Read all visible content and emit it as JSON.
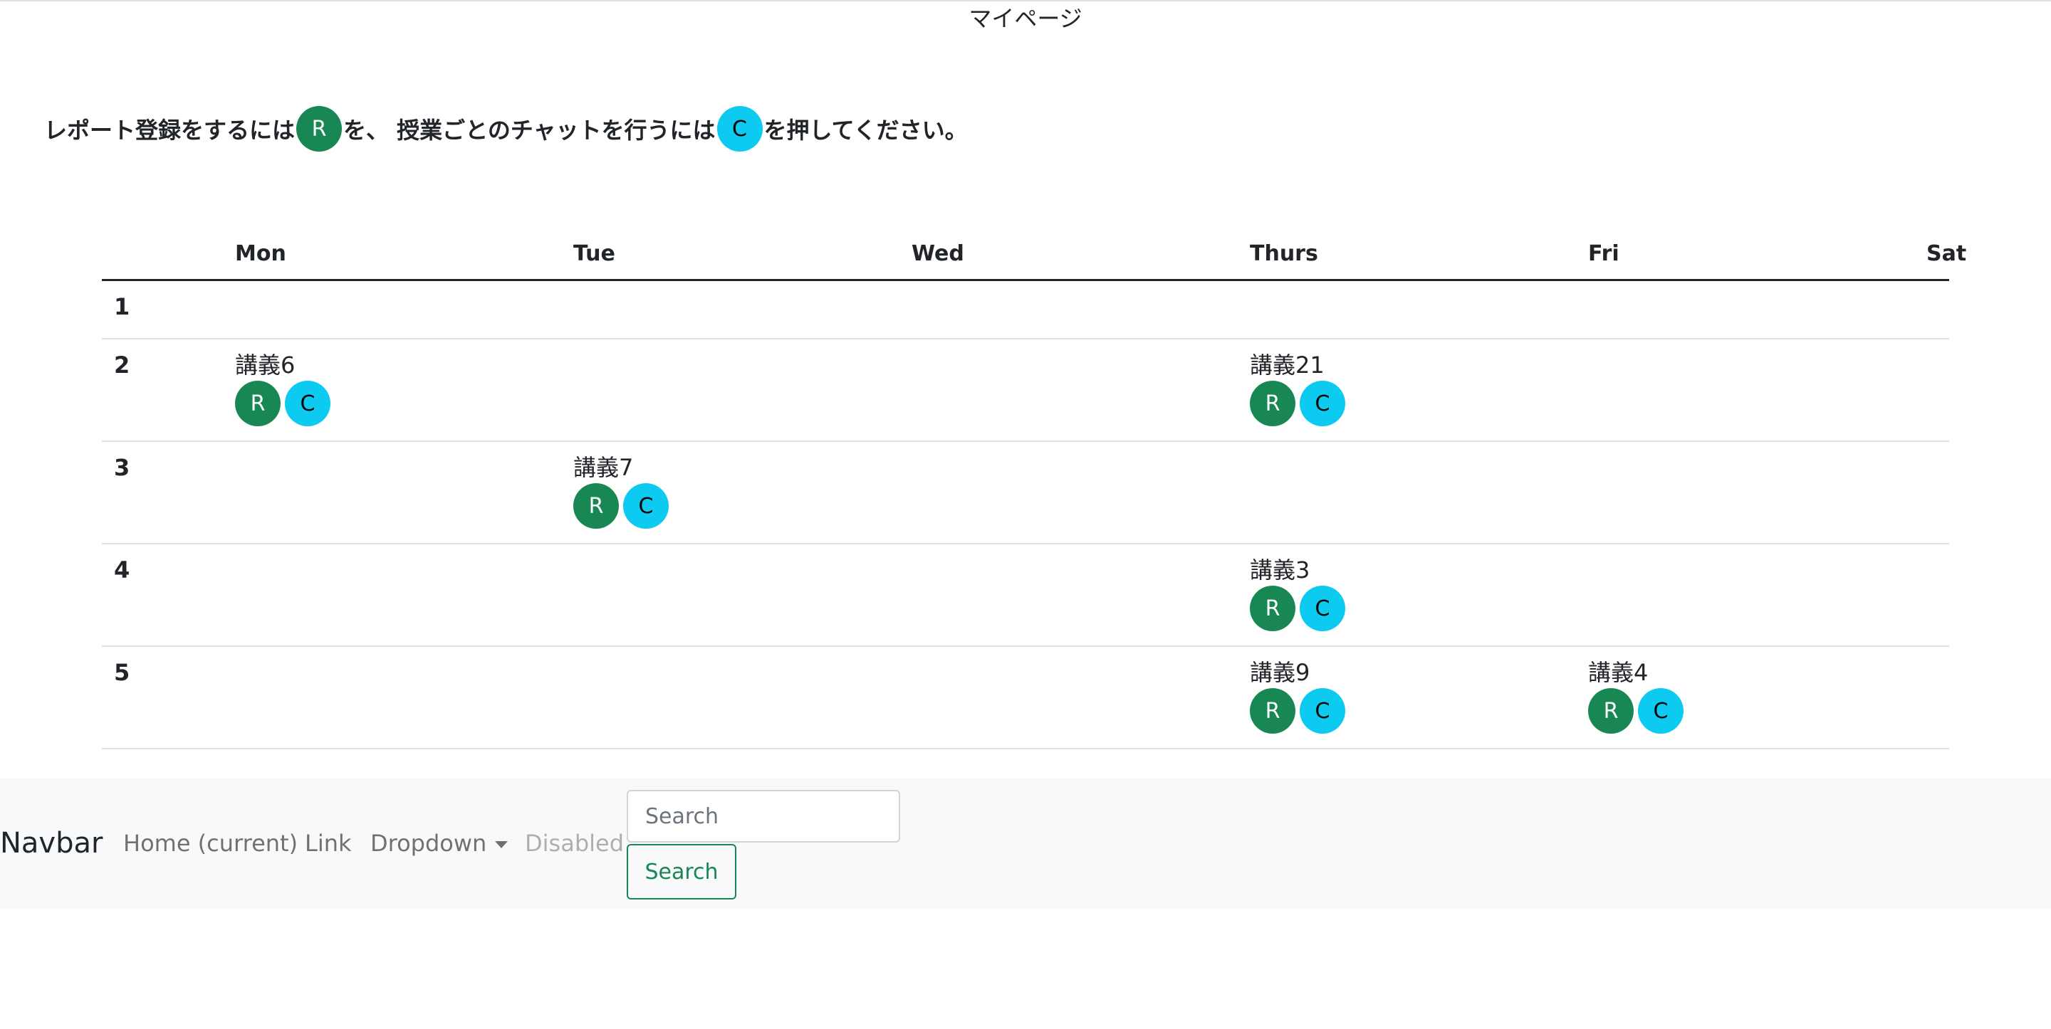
{
  "page": {
    "title": "マイページ",
    "instructions": {
      "part1": "レポート登録をするには",
      "r_label": "R",
      "part2": "を、 授業ごとのチャットを行うには",
      "c_label": "C",
      "part3": "を押してください。"
    }
  },
  "timetable": {
    "days": [
      "Mon",
      "Tue",
      "Wed",
      "Thurs",
      "Fri",
      "Sat"
    ],
    "periods": [
      {
        "period": "1",
        "cells": [
          "",
          "",
          "",
          "",
          "",
          ""
        ]
      },
      {
        "period": "2",
        "cells": [
          "講義6",
          "",
          "",
          "講義21",
          "",
          ""
        ]
      },
      {
        "period": "3",
        "cells": [
          "",
          "講義7",
          "",
          "",
          "",
          ""
        ]
      },
      {
        "period": "4",
        "cells": [
          "",
          "",
          "",
          "講義3",
          "",
          ""
        ]
      },
      {
        "period": "5",
        "cells": [
          "",
          "",
          "",
          "講義9",
          "講義4",
          ""
        ]
      }
    ],
    "report_button_label": "R",
    "chat_button_label": "C"
  },
  "navbar": {
    "brand": "Navbar",
    "links": [
      {
        "label": "Home (current)",
        "disabled": false
      },
      {
        "label": "Link",
        "disabled": false
      },
      {
        "label": "Dropdown",
        "disabled": false
      },
      {
        "label": "Disabled",
        "disabled": true
      }
    ],
    "search": {
      "placeholder": "Search",
      "button_label": "Search"
    }
  },
  "colors": {
    "report_button": "#198754",
    "chat_button": "#0dcaf0",
    "navbar_bg": "#f8f9fa"
  }
}
